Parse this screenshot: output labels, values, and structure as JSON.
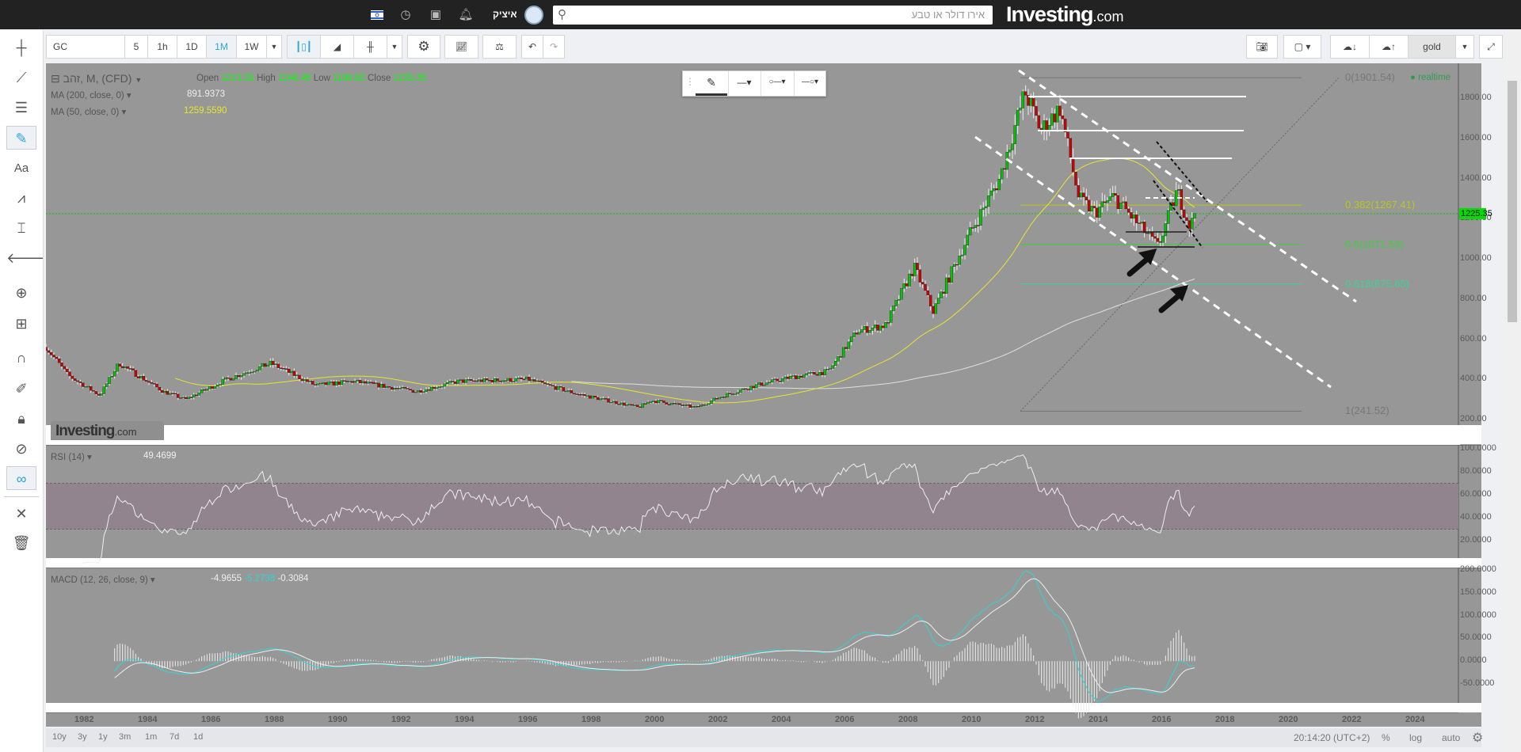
{
  "topbar": {
    "username": "איציק",
    "search_placeholder": "אירו דולר או טבע",
    "logo_main": "Investing",
    "logo_suffix": ".com",
    "icons": [
      "israel-flag-icon",
      "clock-icon",
      "portfolio-icon",
      "bell-icon",
      "avatar-icon",
      "search-icon"
    ]
  },
  "toolbar": {
    "symbol": "GC",
    "intervals": [
      "5",
      "1h",
      "1D",
      "1M",
      "1W"
    ],
    "active_interval": "1M",
    "profile": "gold"
  },
  "legend": {
    "title": "זהב, M, (CFD)",
    "open_label": "Open",
    "open": "1213.25",
    "high_label": "High",
    "high": "1246.45",
    "low_label": "Low",
    "low": "1199.50",
    "close_label": "Close",
    "close": "1225.35",
    "ma200_label": "MA (200, close, 0)",
    "ma200": "891.9373",
    "ma50_label": "MA (50, close, 0)",
    "ma50": "1259.5590",
    "realtime": "realtime"
  },
  "price_axis": {
    "ticks": [
      "1800.00",
      "1600.00",
      "1400.00",
      "1200.00",
      "1000.00",
      "800.00",
      "600.00",
      "400.00",
      "200.00"
    ],
    "current": "1225.35"
  },
  "fib": {
    "l0": "0(1901.54)",
    "l382": "0.382(1267.41)",
    "l5": "0.5(1071.53)",
    "l618": "0.618(875.65)",
    "l1": "1(241.52)"
  },
  "rsi": {
    "label": "RSI (14)",
    "value": "49.4699",
    "ticks": [
      "100.0000",
      "80.0000",
      "60.0000",
      "40.0000",
      "20.0000"
    ]
  },
  "macd": {
    "label": "MACD (12, 26, close, 9)",
    "v1": "-4.9655",
    "v2": "-5.2738",
    "v3": "-0.3084",
    "ticks": [
      "200.0000",
      "150.0000",
      "100.0000",
      "50.0000",
      "0.0000",
      "-50.0000"
    ]
  },
  "time_axis": [
    "1982",
    "1984",
    "1986",
    "1988",
    "1990",
    "1992",
    "1994",
    "1996",
    "1998",
    "2000",
    "2002",
    "2004",
    "2006",
    "2008",
    "2010",
    "2012",
    "2014",
    "2016",
    "2018",
    "2020",
    "2022",
    "2024"
  ],
  "ranges": [
    "10y",
    "3y",
    "1y",
    "3m",
    "1m",
    "7d",
    "1d"
  ],
  "status": {
    "time": "20:14:20 (UTC+2)",
    "percent": "%",
    "log": "log",
    "auto": "auto"
  },
  "watermark": {
    "main": "Investing",
    "suffix": ".com"
  },
  "colors": {
    "up": "#00c800",
    "down": "#cc0000",
    "ma50": "#e6e62e",
    "ma200": "#e0e0e0",
    "rsi_band": "#91848f",
    "macd": "#2fd6d6"
  },
  "price_keypoints": [
    [
      1980.8,
      560
    ],
    [
      1981.5,
      420
    ],
    [
      1982.5,
      320
    ],
    [
      1983.1,
      480
    ],
    [
      1984.5,
      340
    ],
    [
      1985.2,
      300
    ],
    [
      1986.5,
      400
    ],
    [
      1987.9,
      480
    ],
    [
      1989.3,
      370
    ],
    [
      1990.5,
      390
    ],
    [
      1992.5,
      340
    ],
    [
      1993.8,
      390
    ],
    [
      1996.0,
      400
    ],
    [
      1997.5,
      330
    ],
    [
      1999.5,
      260
    ],
    [
      1999.9,
      295
    ],
    [
      2001.3,
      260
    ],
    [
      2002.2,
      320
    ],
    [
      2003.2,
      370
    ],
    [
      2004.3,
      410
    ],
    [
      2005.5,
      440
    ],
    [
      2006.4,
      640
    ],
    [
      2007.3,
      670
    ],
    [
      2008.2,
      960
    ],
    [
      2008.8,
      740
    ],
    [
      2009.9,
      1110
    ],
    [
      2010.9,
      1400
    ],
    [
      2011.7,
      1830
    ],
    [
      2012.2,
      1640
    ],
    [
      2012.8,
      1750
    ],
    [
      2013.4,
      1300
    ],
    [
      2013.9,
      1230
    ],
    [
      2014.5,
      1310
    ],
    [
      2015.9,
      1060
    ],
    [
      2016.5,
      1340
    ],
    [
      2016.9,
      1160
    ],
    [
      2017.1,
      1225
    ]
  ]
}
